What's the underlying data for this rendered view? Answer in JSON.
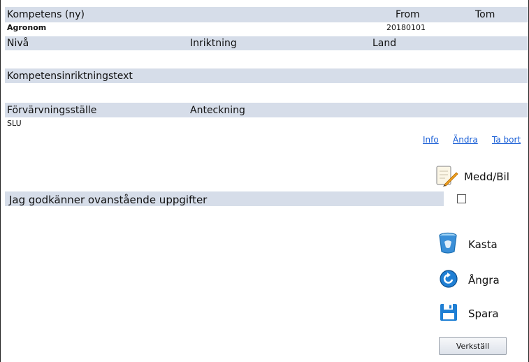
{
  "header": {
    "title": "Kompetens (ny)",
    "from_label": "From",
    "tom_label": "Tom"
  },
  "record": {
    "name": "Agronom",
    "from_value": "20180101"
  },
  "row1": {
    "niva_label": "Nivå",
    "inriktning_label": "Inriktning",
    "land_label": "Land"
  },
  "row2": {
    "text_label": "Kompetensinriktningstext"
  },
  "row3": {
    "ställe_label": "Förvärvningsställe",
    "anteckning_label": "Anteckning",
    "ställe_value": "SLU"
  },
  "links": {
    "info": "Info",
    "andra": "Ändra",
    "ta_bort": "Ta bort"
  },
  "attach": {
    "label": "Medd/Bil",
    "icon": "notepad-pencil-icon"
  },
  "approve": {
    "label": "Jag godkänner ovanstående uppgifter",
    "checked": false
  },
  "actions": {
    "kasta": {
      "label": "Kasta",
      "icon": "trash-bin-icon"
    },
    "angra": {
      "label": "Ångra",
      "icon": "undo-arrow-icon"
    },
    "spara": {
      "label": "Spara",
      "icon": "floppy-disk-icon"
    }
  },
  "submit": {
    "label": "Verkställ"
  },
  "colors": {
    "band": "#d6dde9",
    "link": "#1a5fd6"
  }
}
